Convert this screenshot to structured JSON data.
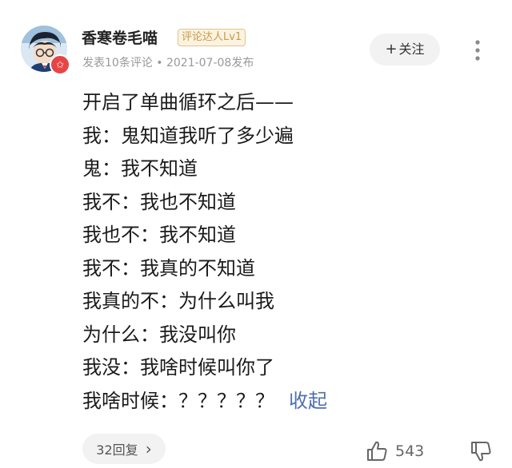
{
  "comment": {
    "author": {
      "name": "香寒卷毛喵",
      "level_badge": "评论达人Lv1",
      "meta": "发表10条评论 • 2021-07-08发布"
    },
    "follow_label": "关注",
    "follow_prefix": "+",
    "lines": [
      "开启了单曲循环之后——",
      "我：鬼知道我听了多少遍",
      "鬼：我不知道",
      "我不：我也不知道",
      "我也不：我不知道",
      "我不：我真的不知道",
      "我真的不：为什么叫我",
      "为什么：我没叫你",
      "我没：我啥时候叫你了",
      "我啥时候：？？？？？"
    ],
    "collapse_label": "收起",
    "reply_label": "32回复",
    "reply_chevron": "›",
    "like_count": "543"
  },
  "icons": {
    "avatar": "avatar-image",
    "badge": "star-badge-icon",
    "more": "more-vertical-icon",
    "like": "thumbs-up-icon",
    "dislike": "thumbs-down-icon"
  },
  "colors": {
    "accent_link": "#4f6fb3",
    "badge_bg": "#fbf3e2",
    "badge_text": "#c99a45",
    "star_badge": "#e64545"
  }
}
